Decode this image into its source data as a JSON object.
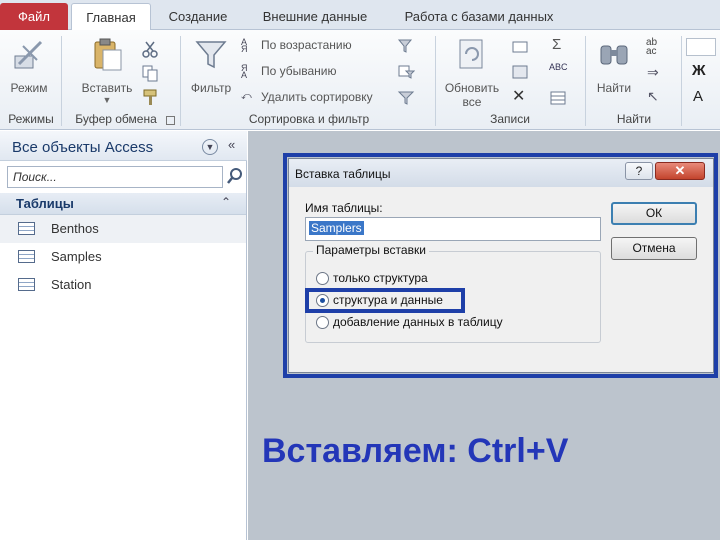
{
  "tabs": {
    "file": "Файл",
    "items": [
      "Главная",
      "Создание",
      "Внешние данные",
      "Работа с базами данных"
    ]
  },
  "ribbon": {
    "view_label": "Режим",
    "views_group": "Режимы",
    "paste_label": "Вставить",
    "clipboard_group": "Буфер обмена",
    "filter_label": "Фильтр",
    "sort_asc": "По возрастанию",
    "sort_desc": "По убыванию",
    "sort_remove": "Удалить сортировку",
    "sortfilter_group": "Сортировка и фильтр",
    "refresh_label": "Обновить",
    "refresh_sub": "все",
    "records_group": "Записи",
    "find_label": "Найти",
    "find_group": "Найти",
    "bold_glyph": "Ж",
    "font_glyph": "А",
    "sigma_glyph": "Σ",
    "spell_glyph": "ABC",
    "ab_glyph": "ab",
    "ac_glyph": "ac",
    "sort_glyph_az": "А",
    "sort_glyph_ya": "Я",
    "delete_glyph": "✕"
  },
  "nav": {
    "title": "Все объекты Access",
    "collapse": "«",
    "search_placeholder": "Поиск...",
    "section": "Таблицы",
    "section_arrow": "≈",
    "items": [
      "Benthos",
      "Samples",
      "Station"
    ]
  },
  "dialog": {
    "title": "Вставка таблицы",
    "help": "?",
    "close": "✕",
    "name_label": "Имя таблицы:",
    "name_value": "Samplers",
    "ok": "ОК",
    "cancel": "Отмена",
    "options_legend": "Параметры вставки",
    "options": [
      "только структура",
      "структура и данные",
      "добавление данных в таблицу"
    ],
    "selected_option": "структура и данные"
  },
  "caption": "Вставляем: Ctrl+V",
  "colors": {
    "file_tab": "#c2353c",
    "highlight": "#1e3fa8",
    "caption": "#2336b8"
  }
}
